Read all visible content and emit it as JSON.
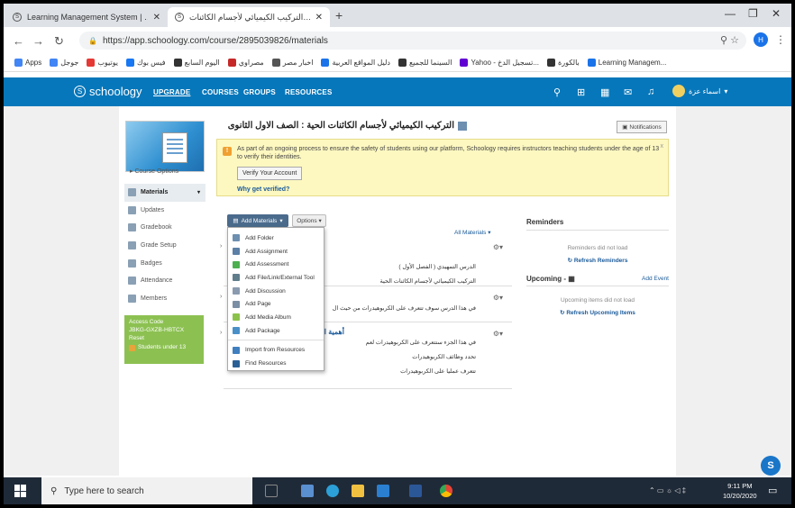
{
  "browser": {
    "tabs": [
      {
        "title": "Learning Management System | …",
        "active": false
      },
      {
        "title": "التركيب الكيميائي لأجسام الكائنات…",
        "active": true
      }
    ],
    "new_tab": "+",
    "window_controls": [
      "—",
      "❐",
      "✕"
    ],
    "url": "https://app.schoology.com/course/2895039826/materials",
    "profile_initial": "H",
    "bookmarks": [
      {
        "label": "Apps",
        "color": "#4285f4"
      },
      {
        "label": "جوجل",
        "color": "#4285f4"
      },
      {
        "label": "يوتيوب",
        "color": "#e53935"
      },
      {
        "label": "فيس بوك",
        "color": "#1877f2"
      },
      {
        "label": "اليوم السابع",
        "color": "#333333"
      },
      {
        "label": "مصراوي",
        "color": "#c62828"
      },
      {
        "label": "اخبار مصر",
        "color": "#555555"
      },
      {
        "label": "دليل المواقع العربية",
        "color": "#1a73e8"
      },
      {
        "label": "السينما للجميع",
        "color": "#333333"
      },
      {
        "label": "Yahoo - تسجيل الدخ...",
        "color": "#6001d2"
      },
      {
        "label": "بالكورة",
        "color": "#333333"
      },
      {
        "label": "Learning Managem...",
        "color": "#1a73e8"
      }
    ]
  },
  "header": {
    "logo": "schoology",
    "nav": [
      "UPGRADE",
      "COURSES",
      "GROUPS",
      "RESOURCES"
    ],
    "user_name": "اسماء عزة"
  },
  "sidebar": {
    "course_options": "Course Options",
    "items": [
      {
        "label": "Materials",
        "active": true
      },
      {
        "label": "Updates"
      },
      {
        "label": "Gradebook"
      },
      {
        "label": "Grade Setup"
      },
      {
        "label": "Badges"
      },
      {
        "label": "Attendance"
      },
      {
        "label": "Members"
      }
    ],
    "access_code_label": "Access Code",
    "access_code": "JBKG-GXZB-HBTCX",
    "reset": "Reset",
    "students_under_13": "Students under 13"
  },
  "main": {
    "title": "التركيب الكيميائي لأجسام الكائنات الحية : الصف الاول الثانوى",
    "notifications_label": "Notifications",
    "notice_text": "As part of an ongoing process to ensure the safety of students using our platform, Schoology requires instructors teaching students under the age of 13 to verify their identities.",
    "verify_button": "Verify Your Account",
    "why_link": "Why get verified?",
    "close": "x",
    "add_materials": "Add Materials",
    "options": "Options",
    "all_materials": "All Materials",
    "dropdown": [
      {
        "label": "Add Folder",
        "color": "#6d8fb0"
      },
      {
        "label": "Add Assignment",
        "color": "#5b7fa6"
      },
      {
        "label": "Add Assessment",
        "color": "#4caf50"
      },
      {
        "label": "Add File/Link/External Tool",
        "color": "#607d8b"
      },
      {
        "label": "Add Discussion",
        "color": "#8a9bb0"
      },
      {
        "label": "Add Page",
        "color": "#7a8ea4"
      },
      {
        "label": "Add Media Album",
        "color": "#8bc34a"
      },
      {
        "label": "Add Package",
        "color": "#4a90c8"
      }
    ],
    "dropdown_resources": [
      {
        "label": "Import from Resources",
        "color": "#3f7fbf"
      },
      {
        "label": "Find Resources",
        "color": "#2a5f95"
      }
    ],
    "folders": [
      {
        "title": "",
        "lines": [
          "الدرس التمهيدي ( الفصل الأول )",
          "التركيب الكيميائي لأجسام الكائنات الحية"
        ]
      },
      {
        "title": "",
        "lines": [
          "في هذا الدرس سوف تتعرف على الكربوهيدرات من حيث ال"
        ]
      },
      {
        "title": "أهمية ال",
        "lines": [
          "في هذا الجزء ستتعرف على الكربوهيدرات لعم",
          "تحدد وظائف الكربوهيدرات",
          "تتعرف عمليا على الكربوهيدرات"
        ]
      }
    ],
    "gear": "⚙▾",
    "chev": "›"
  },
  "reminders": {
    "title": "Reminders",
    "empty": "Reminders did not load",
    "refresh": "Refresh Reminders",
    "upcoming_title": "Upcoming",
    "add_event": "Add Event",
    "upcoming_empty": "Upcoming items did not load",
    "refresh_upcoming": "Refresh Upcoming Items"
  },
  "fab": "S",
  "taskbar": {
    "search_placeholder": "Type here to search",
    "time": "9:11 PM",
    "date": "10/20/2020"
  }
}
